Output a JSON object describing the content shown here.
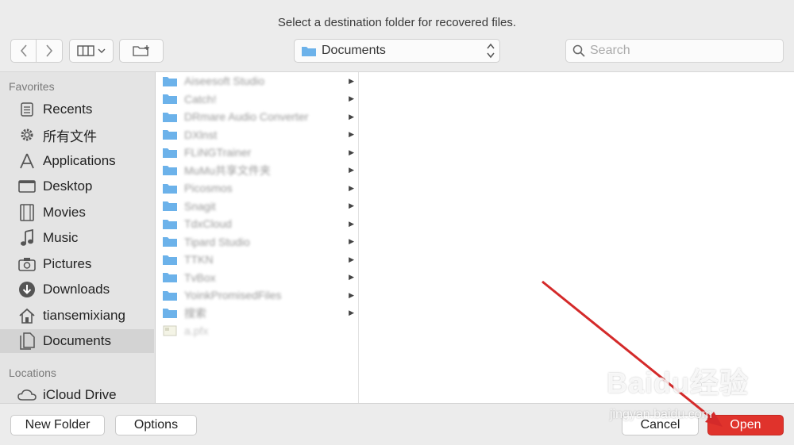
{
  "dialog": {
    "title": "Select a destination folder for recovered files."
  },
  "toolbar": {
    "back_icon": "chevron-left-icon",
    "forward_icon": "chevron-right-icon",
    "view_icon": "column-view-icon",
    "new_folder_icon": "new-folder-icon",
    "location": "Documents",
    "search_placeholder": "Search"
  },
  "sidebar": {
    "favorites_header": "Favorites",
    "favorites": [
      {
        "label": "Recents",
        "icon": "recents-icon"
      },
      {
        "label": "所有文件",
        "icon": "gear-icon"
      },
      {
        "label": "Applications",
        "icon": "applications-icon"
      },
      {
        "label": "Desktop",
        "icon": "desktop-icon"
      },
      {
        "label": "Movies",
        "icon": "film-icon"
      },
      {
        "label": "Music",
        "icon": "music-note-icon"
      },
      {
        "label": "Pictures",
        "icon": "camera-icon"
      },
      {
        "label": "Downloads",
        "icon": "download-icon"
      },
      {
        "label": "tiansemixiang",
        "icon": "home-icon"
      },
      {
        "label": "Documents",
        "icon": "document-icon",
        "selected": true
      }
    ],
    "locations_header": "Locations",
    "locations": [
      {
        "label": "iCloud Drive",
        "icon": "cloud-icon"
      }
    ]
  },
  "files": [
    {
      "name": "Aiseesoft Studio",
      "type": "folder"
    },
    {
      "name": "Catch!",
      "type": "folder"
    },
    {
      "name": "DRmare Audio Converter",
      "type": "folder"
    },
    {
      "name": "DXlnst",
      "type": "folder"
    },
    {
      "name": "FLiNGTrainer",
      "type": "folder"
    },
    {
      "name": "MuMu共享文件夹",
      "type": "folder"
    },
    {
      "name": "Picosmos",
      "type": "folder"
    },
    {
      "name": "Snagit",
      "type": "folder"
    },
    {
      "name": "TdxCloud",
      "type": "folder"
    },
    {
      "name": "Tipard Studio",
      "type": "folder"
    },
    {
      "name": "TTKN",
      "type": "folder"
    },
    {
      "name": "TvBox",
      "type": "folder"
    },
    {
      "name": "YoinkPromisedFiles",
      "type": "folder"
    },
    {
      "name": "搜索",
      "type": "folder"
    },
    {
      "name": "a.pfx",
      "type": "file"
    }
  ],
  "buttons": {
    "new_folder": "New Folder",
    "options": "Options",
    "cancel": "Cancel",
    "open": "Open"
  },
  "colors": {
    "open_button": "#e0332c",
    "folder": "#6cb2ea",
    "annotation_arrow": "#d42a2a"
  },
  "watermark": {
    "main": "Baidu经验",
    "sub": "jingyan.baidu.com"
  }
}
